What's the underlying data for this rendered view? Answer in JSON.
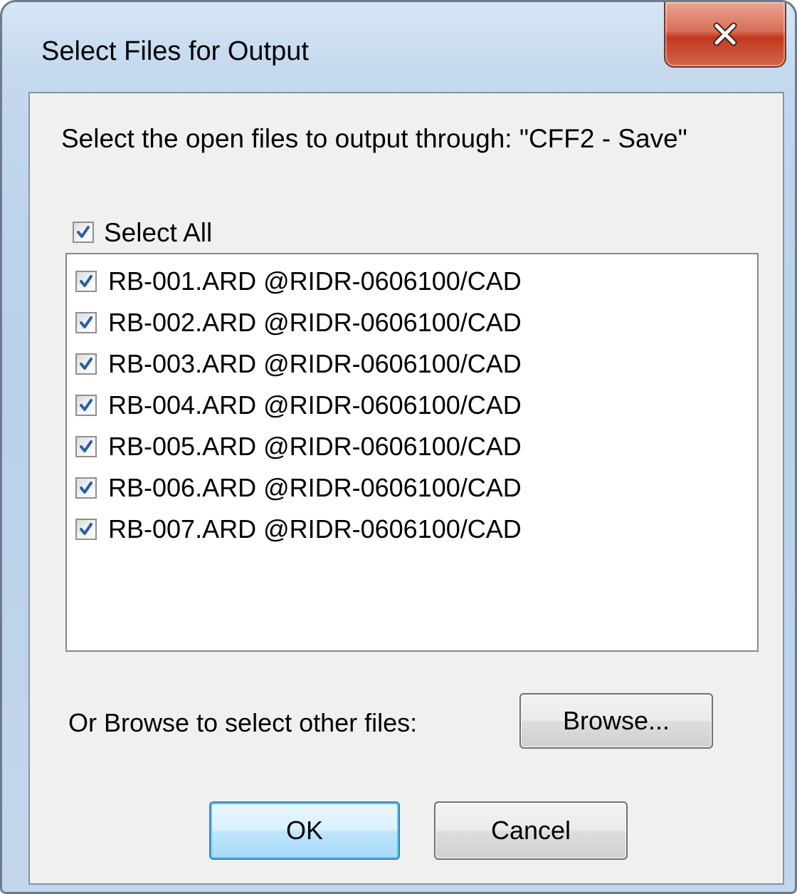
{
  "window": {
    "title": "Select Files for Output",
    "close_icon": "close-x-icon"
  },
  "dialog": {
    "prompt": "Select the open files to output through: \"CFF2 - Save\"",
    "select_all": {
      "label": "Select All",
      "checked": true
    },
    "files": [
      {
        "label": "RB-001.ARD @RIDR-0606100/CAD",
        "checked": true
      },
      {
        "label": "RB-002.ARD @RIDR-0606100/CAD",
        "checked": true
      },
      {
        "label": "RB-003.ARD @RIDR-0606100/CAD",
        "checked": true
      },
      {
        "label": "RB-004.ARD @RIDR-0606100/CAD",
        "checked": true
      },
      {
        "label": "RB-005.ARD @RIDR-0606100/CAD",
        "checked": true
      },
      {
        "label": "RB-006.ARD @RIDR-0606100/CAD",
        "checked": true
      },
      {
        "label": "RB-007.ARD @RIDR-0606100/CAD",
        "checked": true
      }
    ],
    "browse_text": "Or Browse to select other files:",
    "browse_button": "Browse...",
    "ok_button": "OK",
    "cancel_button": "Cancel"
  },
  "colors": {
    "check_mark": "#2a5ea8",
    "ok_focus_border": "#3c7fb1",
    "close_button_red": "#c0391f"
  }
}
